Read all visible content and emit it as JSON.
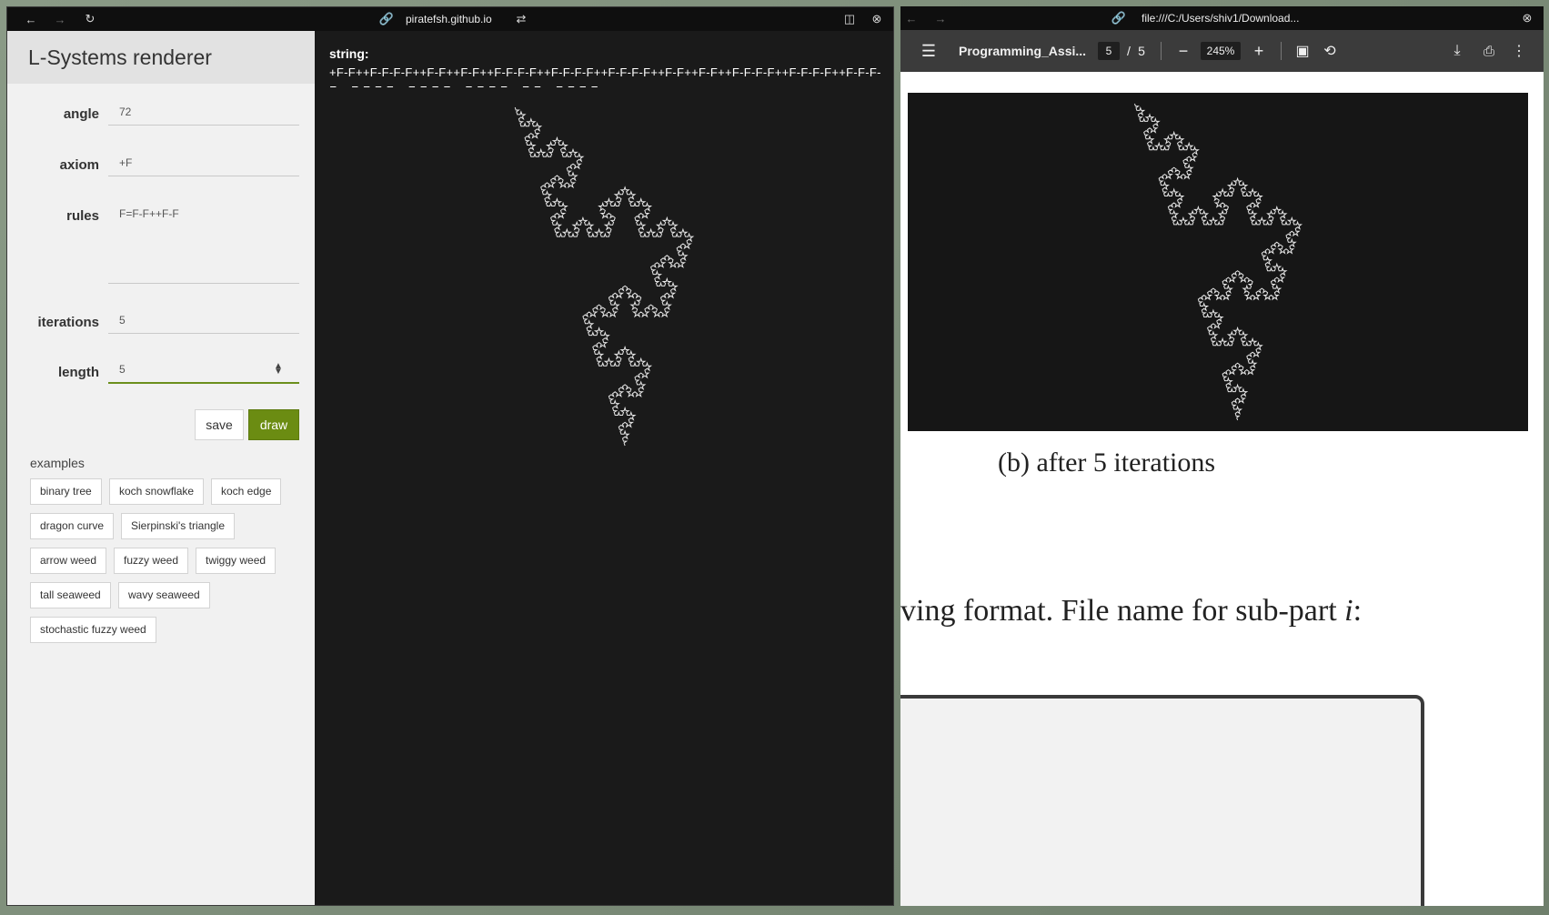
{
  "left_window": {
    "url": "piratefsh.github.io",
    "app_title": "L-Systems renderer",
    "fields": {
      "angle": {
        "label": "angle",
        "value": "72"
      },
      "axiom": {
        "label": "axiom",
        "value": "+F"
      },
      "rules": {
        "label": "rules",
        "value": "F=F-F++F-F"
      },
      "iterations": {
        "label": "iterations",
        "value": "5"
      },
      "length": {
        "label": "length",
        "value": "5"
      }
    },
    "buttons": {
      "save": "save",
      "draw": "draw"
    },
    "examples_label": "examples",
    "examples": [
      "binary tree",
      "koch snowflake",
      "koch edge",
      "dragon curve",
      "Sierpinski's triangle",
      "arrow weed",
      "fuzzy weed",
      "twiggy weed",
      "tall seaweed",
      "wavy seaweed",
      "stochastic fuzzy weed"
    ],
    "string_label": "string:",
    "string_value": "+F-F++F-F-F-F++F-F++F-F++F-F-F-F++F-F-F-F++F-F-F-F++F-F++F-F++F-F-F-F++F-F-F-F++F-F-F-F++F-F-F-F++F-F-F-F++F-F-F-F++F-F++F-F-F-F"
  },
  "right_window": {
    "url": "file:///C:/Users/shiv1/Download...",
    "pdf_title": "Programming_Assi...",
    "page_current": "5",
    "page_separator": "/",
    "page_total": "5",
    "zoom": "245%",
    "caption": "(b) after 5 iterations",
    "body_line": "ving format.  File name for sub-part ",
    "body_line_var": "i",
    "body_line_end": ":"
  },
  "colors": {
    "accent_green": "#6b8c12",
    "canvas_bg": "#1a1a1a",
    "curve_stroke": "#e6e6e6"
  }
}
